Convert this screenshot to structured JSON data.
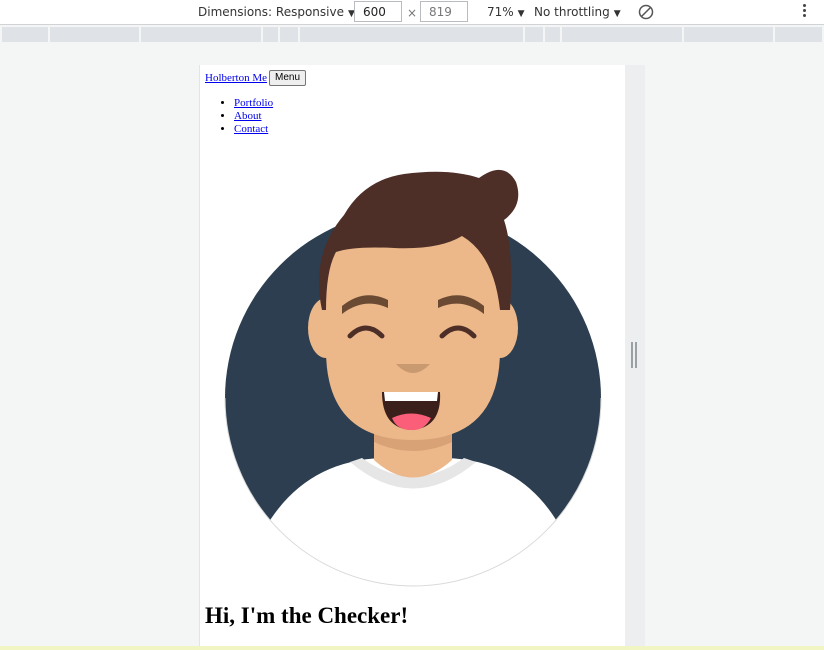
{
  "devtools": {
    "dimensions_label": "Dimensions: Responsive",
    "width_value": "600",
    "height_value": "819",
    "zoom_label": "71%",
    "throttling_label": "No throttling",
    "times_symbol": "×",
    "caret": "▼"
  },
  "page": {
    "brand_link": "Holberton Me",
    "menu_button": "Menu",
    "nav_links": [
      "Portfolio",
      "About",
      "Contact"
    ],
    "hero_heading": "Hi, I'm the Checker!"
  },
  "colors": {
    "avatar_circle": "#2c3e50",
    "hair": "#4d2f28",
    "skin": "#ecb88a",
    "shirt": "#ffffff",
    "mouth": "#3b1f1a",
    "tongue": "#fb5e78",
    "link": "#0000ee"
  },
  "icons": [
    "dropdown-caret-icon",
    "rotate-icon",
    "kebab-menu-icon",
    "resize-handle-icon"
  ]
}
